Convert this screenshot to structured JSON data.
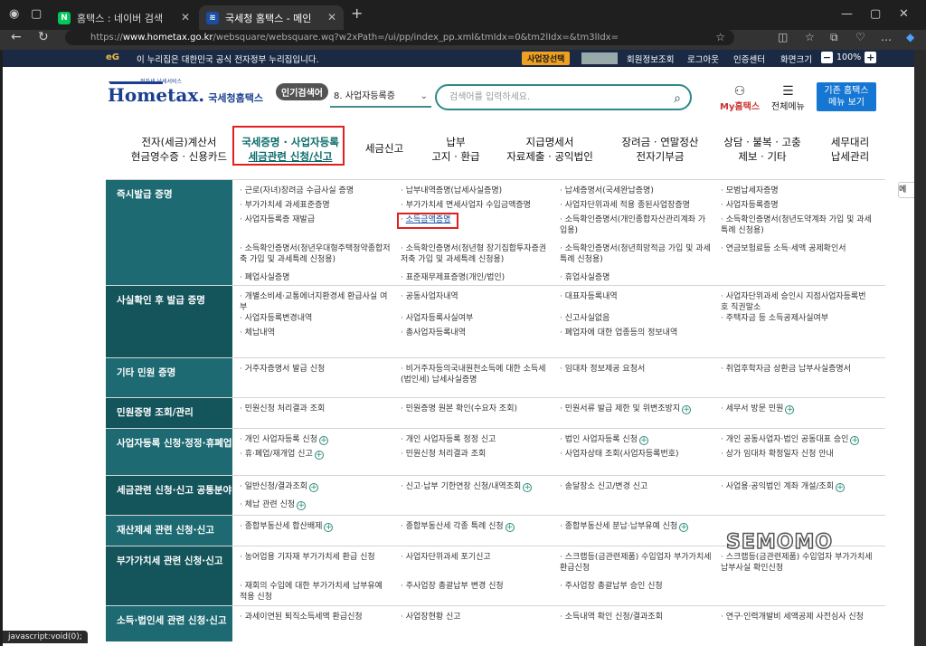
{
  "browser": {
    "tabs": [
      {
        "title": "홈택스 : 네이버 검색",
        "favicon": "N",
        "color": "#03c75a"
      },
      {
        "title": "국세청 홈택스 - 메인",
        "favicon": "≋",
        "color": "#1a4ea0"
      }
    ],
    "url_prefix": "https://",
    "url_domain": "www.hometax.go.kr",
    "url_path": "/websquare/websquare.wq?w2xPath=/ui/pp/index_pp.xml&tmIdx=0&tm2lIdx=&tm3lIdx=",
    "status_text": "javascript:void(0);"
  },
  "notice": {
    "emblem": "eG",
    "text": "이 누리집은 대한민국 공식 전자정부 누리집입니다.",
    "login_badge": "사업장선택",
    "links": [
      "회원정보조회",
      "로그아웃",
      "인증센터",
      "화면크기"
    ],
    "zoom": "100%"
  },
  "header": {
    "logo_text": "Hometax.",
    "logo_sub": "국세청홈택스",
    "logo_tagline": "전자세 납세서비스",
    "search_badge": "인기검색어",
    "search_select": "8.  사업자등록증",
    "search_placeholder": "검색어를 입력하세요.",
    "my_label": "My홈택스",
    "all_menu_label": "전체메뉴",
    "classic_line1": "기존 홈택스",
    "classic_line2": "메뉴 보기"
  },
  "gnb": [
    {
      "l1": "전자(세금)계산서",
      "l2": "현금영수증 · 신용카드"
    },
    {
      "l1": "국세증명 · 사업자등록",
      "l2": "세금관련 신청/신고"
    },
    {
      "l1": "세금신고",
      "l2": ""
    },
    {
      "l1": "납부",
      "l2": "고지 · 환급"
    },
    {
      "l1": "지급명세서",
      "l2": "자료제출 · 공익법인"
    },
    {
      "l1": "장려금 · 연말정산",
      "l2": "전자기부금"
    },
    {
      "l1": "상담 · 불복 · 고충",
      "l2": "제보 · 기타"
    },
    {
      "l1": "세무대리",
      "l2": "납세관리"
    }
  ],
  "rows": [
    {
      "head": "즉시발급 증명",
      "items": [
        [
          "근로(자녀)장려금 수급사실 증명",
          "납부내역증명(납세사실증명)",
          "납세증명서(국세완납증명)",
          "모범납세자증명"
        ],
        [
          "부가가치세 과세표준증명",
          "부가가치세 면세사업자 수입금액증명",
          "사업자단위과세 적용 종된사업장증명",
          "사업자등록증명"
        ],
        [
          "사업자등록증 재발급",
          "소득금액증명",
          "소득확인증명서(개인종합자산관리계좌 가입용)",
          "소득확인증명서(청년도약계좌 가입 및 과세특례 신청용)"
        ],
        [
          "소득확인증명서(청년우대형주택청약종합저축 가입 및 과세특례 신청용)",
          "소득확인증명서(청년형 장기집합투자증권저축 가입 및 과세특례 신청용)",
          "소득확인증명서(청년희망적금 가입 및 과세특례 신청용)",
          "연금보험료등 소득·세액 공제확인서"
        ],
        [
          "폐업사실증명",
          "표준재무제표증명(개인/법인)",
          "휴업사실증명",
          ""
        ]
      ]
    },
    {
      "head": "사실확인 후 발급 증명",
      "items": [
        [
          "개별소비세·교통에너지환경세 환급사실 여부",
          "공동사업자내역",
          "대표자등록내역",
          "사업자단위과세 승인시 지점사업자등록번호 직권말소"
        ],
        [
          "사업자등록변경내역",
          "사업자등록사실여부",
          "신고사실없음",
          "주택자금 등 소득공제사실여부"
        ],
        [
          "체납내역",
          "총사업자등록내역",
          "폐업자에 대한 업종등의 정보내역",
          ""
        ]
      ]
    },
    {
      "head": "기타 민원 증명",
      "items": [
        [
          "거주자증명서 발급 신청",
          "비거주자등의국내원천소득에 대한 소득세(법인세) 납세사실증명",
          "임대차 정보제공 요청서",
          "취업후학자금 상환금 납부사실증명서"
        ]
      ]
    },
    {
      "head": "민원증명 조회/관리",
      "items": [
        [
          "민원신청 처리결과 조회",
          "민원증명 원본 확인(수요자 조회)",
          "민원서류 발급 제한 및 위변조방지",
          "세무서 방문 민원"
        ]
      ]
    },
    {
      "head": "사업자등록 신청·정정·휴폐업",
      "items": [
        [
          "개인 사업자등록 신청",
          "개인 사업자등록 정정 신고",
          "법인 사업자등록 신청",
          "개인 공동사업자·법인 공동대표 승인"
        ],
        [
          "휴·폐업/재개업 신고",
          "민원신청 처리결과 조회",
          "사업자상태 조회(사업자등록번호)",
          "상가 임대차 확정일자 신청 안내"
        ]
      ]
    },
    {
      "head": "세금관련 신청·신고 공통분야",
      "items": [
        [
          "일반신청/결과조회",
          "신고·납부 기한연장 신청/내역조회",
          "송달장소 신고/변경 신고",
          "사업용·공익법인 계좌 개설/조회"
        ],
        [
          "체납 관련 신청",
          "",
          "",
          ""
        ]
      ]
    },
    {
      "head": "재산제세 관련 신청·신고",
      "items": [
        [
          "종합부동산세 합산배제",
          "종합부동산세 각종 특례 신청",
          "종합부동산세 분납·납부유예 신청",
          ""
        ]
      ]
    },
    {
      "head": "부가가치세 관련 신청·신고",
      "items": [
        [
          "농어업용 기자재 부가가치세 환급 신청",
          "사업자단위과세 포기신고",
          "스크랩등(금관련제품) 수입업자 부가가치세 환급신청",
          "스크랩등(금관련제품) 수입업자 부가가치세 납부사실 확인신청"
        ],
        [
          "재회의 수입에 대한 부가가치세 납부유예 적용 신청",
          "주사업장 총괄납부 변경 신청",
          "주사업장 총괄납부 승인 신청",
          ""
        ]
      ]
    },
    {
      "head": "소득·법인세 관련 신청·신고",
      "items": [
        [
          "과세이연된 퇴직소득세액 환급신청",
          "사업장현황 신고",
          "소득내역 확인 신청/결과조회",
          "연구·인력개발비 세액공제 사전심사 신청"
        ]
      ]
    }
  ],
  "plus_items": [
    "개인 사업자등록 신청",
    "개인 공동사업자·법인 공동대표 승인",
    "휴·폐업/재개업 신고",
    "법인 사업자등록 신청",
    "일반신청/결과조회",
    "신고·납부 기한연장 신청/내역조회",
    "사업용·공익법인 계좌 개설/조회",
    "체납 관련 신청",
    "종합부동산세 합산배제",
    "종합부동산세 각종 특례 신청",
    "종합부동산세 분납·납부유예 신청",
    "민원서류 발급 제한 및 위변조방지",
    "세무서 방문 민원"
  ],
  "highlight_item": "소득금액증명",
  "watermark": "SEMOMO",
  "side_tab": "메",
  "colors": {
    "rowhead": "#1d6a72",
    "highlight_box": "#e0201e",
    "accent": "#0a6b6b"
  }
}
